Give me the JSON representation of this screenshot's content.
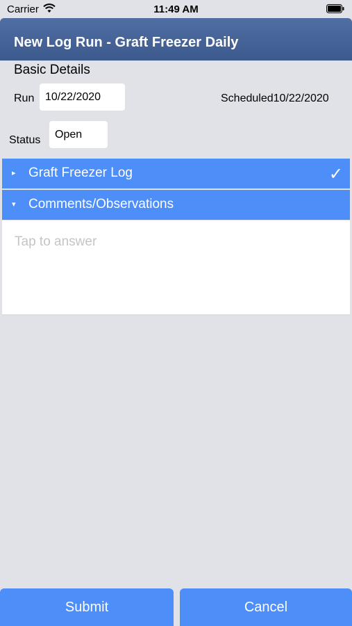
{
  "status_bar": {
    "carrier": "Carrier",
    "time": "11:49 AM"
  },
  "header": {
    "title": "New Log Run - Graft Freezer Daily"
  },
  "basic_details": {
    "title": "Basic Details",
    "run_label": "Run",
    "run_value": "10/22/2020",
    "scheduled_label": "Scheduled",
    "scheduled_value": "10/22/2020",
    "status_label": "Status",
    "status_value": "Open"
  },
  "sections": [
    {
      "label": "Graft Freezer Log",
      "caret": "▸",
      "complete_mark": "✓"
    },
    {
      "label": "Comments/Observations",
      "caret": "▾"
    }
  ],
  "comments": {
    "placeholder": "Tap to answer"
  },
  "footer": {
    "submit_label": "Submit",
    "cancel_label": "Cancel"
  },
  "colors": {
    "accent": "#4d8ef9",
    "nav": "#46659a",
    "background": "#e1e2e8"
  }
}
